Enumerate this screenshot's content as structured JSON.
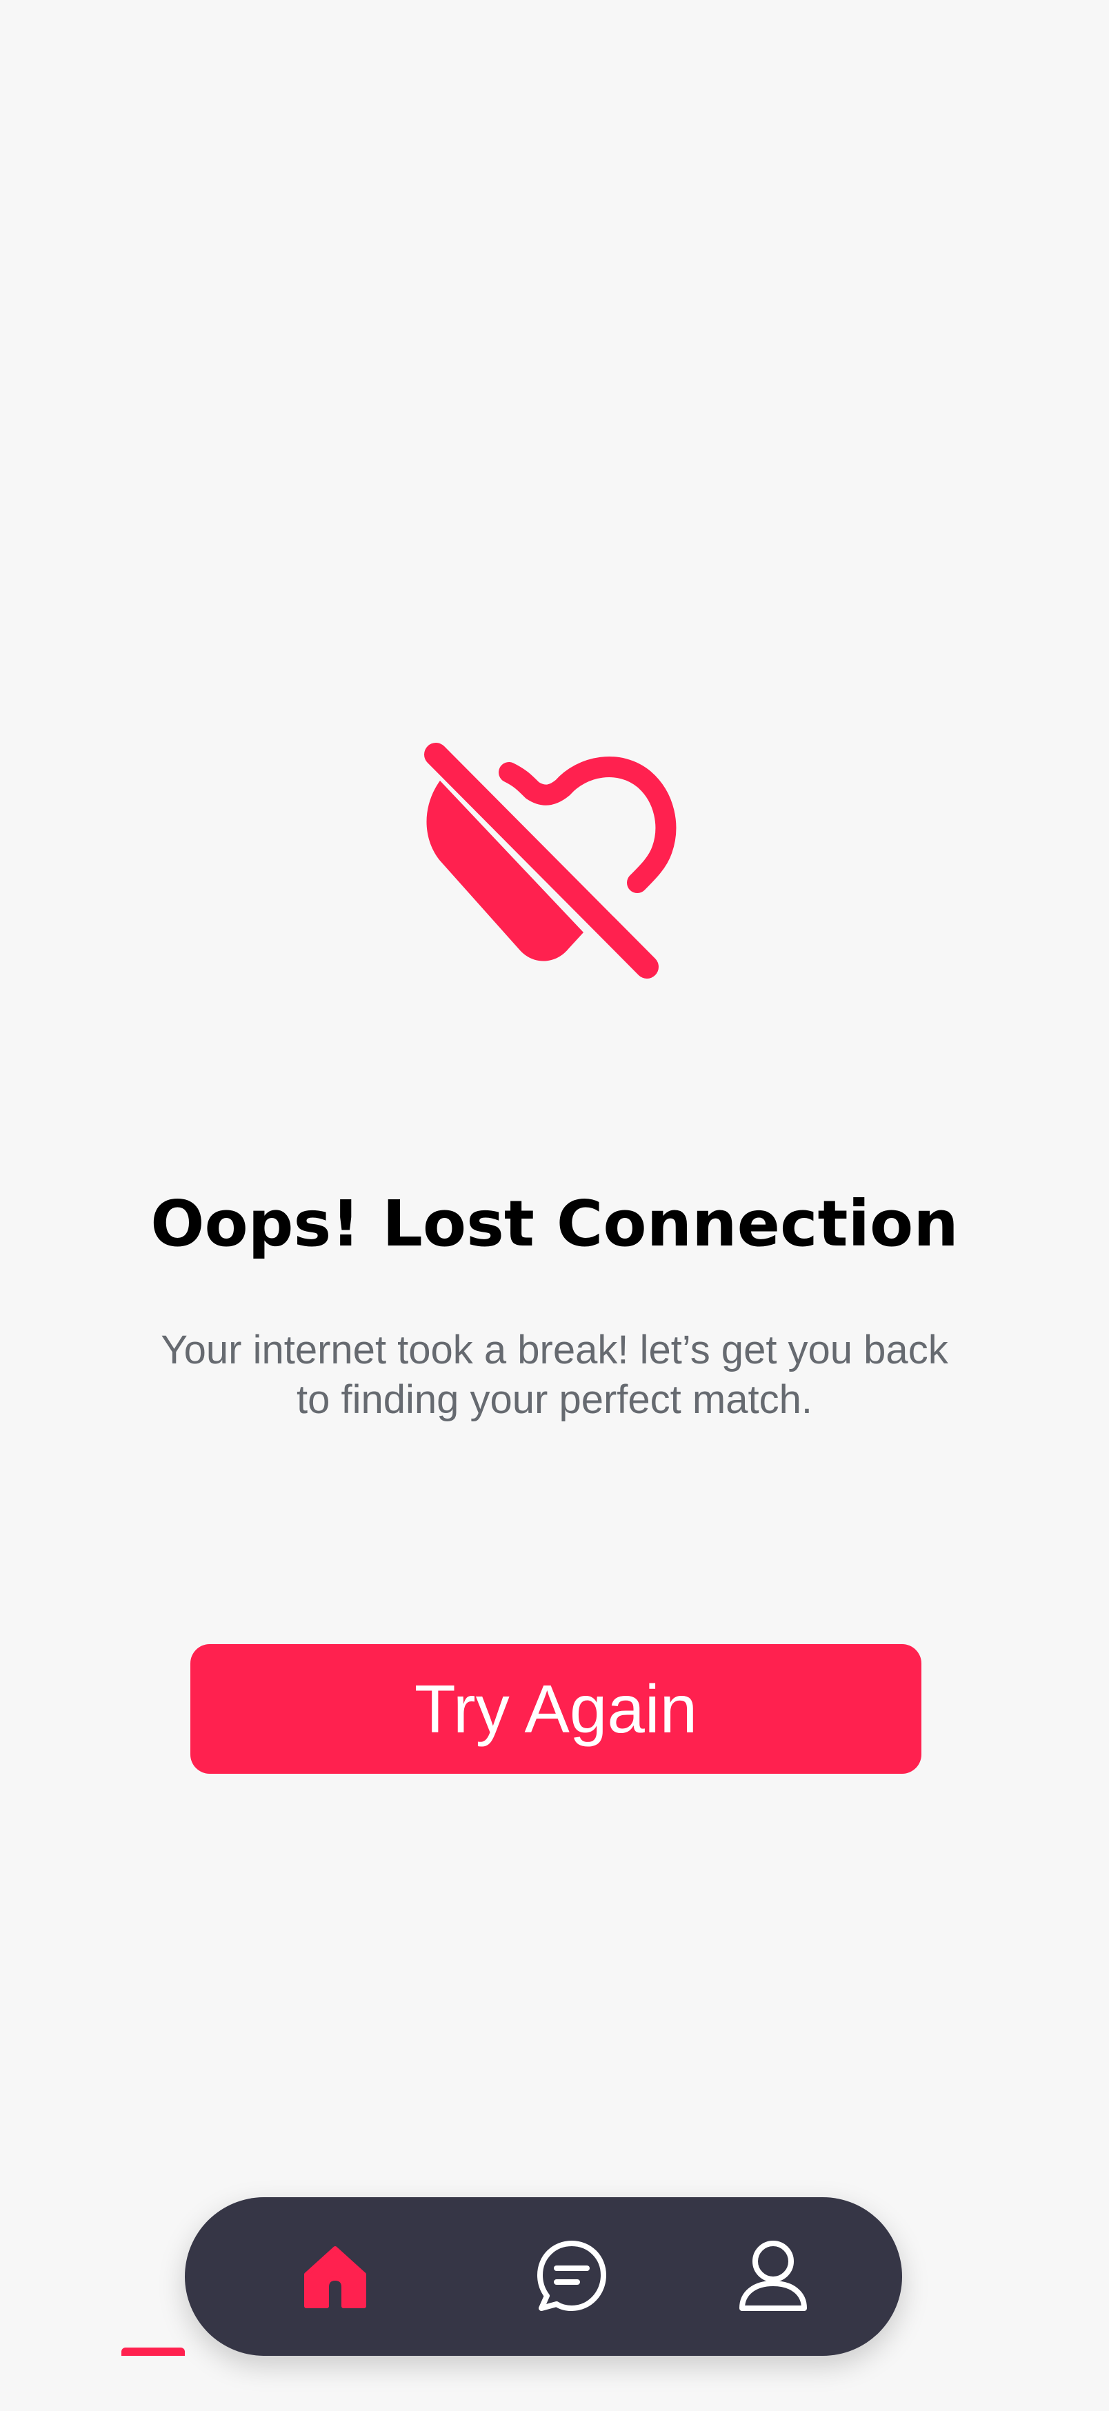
{
  "error_state": {
    "icon": "broken-heart-icon",
    "title": "Oops! Lost Connection",
    "message": "Your internet took a break! let’s get you back to finding your perfect match."
  },
  "actions": {
    "retry_label": "Try Again"
  },
  "bottom_nav": {
    "items": [
      {
        "icon": "home-icon",
        "active": true
      },
      {
        "icon": "chat-icon",
        "active": false
      },
      {
        "icon": "profile-icon",
        "active": false
      }
    ]
  },
  "colors": {
    "accent": "#ff214f",
    "background": "#f7f7f7",
    "nav_background": "#363646",
    "title": "#000000",
    "body_text": "#666a70"
  }
}
